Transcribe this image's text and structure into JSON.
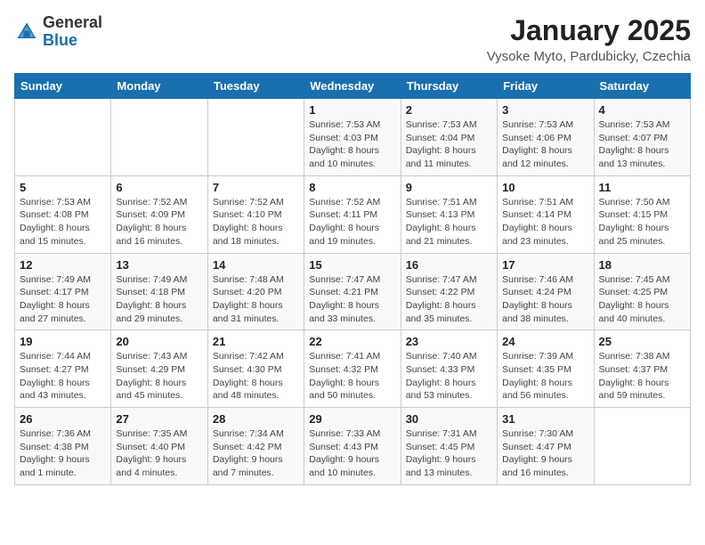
{
  "logo": {
    "general": "General",
    "blue": "Blue"
  },
  "title": "January 2025",
  "subtitle": "Vysoke Myto, Pardubicky, Czechia",
  "days_of_week": [
    "Sunday",
    "Monday",
    "Tuesday",
    "Wednesday",
    "Thursday",
    "Friday",
    "Saturday"
  ],
  "weeks": [
    [
      {
        "day": "",
        "info": ""
      },
      {
        "day": "",
        "info": ""
      },
      {
        "day": "",
        "info": ""
      },
      {
        "day": "1",
        "info": "Sunrise: 7:53 AM\nSunset: 4:03 PM\nDaylight: 8 hours and 10 minutes."
      },
      {
        "day": "2",
        "info": "Sunrise: 7:53 AM\nSunset: 4:04 PM\nDaylight: 8 hours and 11 minutes."
      },
      {
        "day": "3",
        "info": "Sunrise: 7:53 AM\nSunset: 4:06 PM\nDaylight: 8 hours and 12 minutes."
      },
      {
        "day": "4",
        "info": "Sunrise: 7:53 AM\nSunset: 4:07 PM\nDaylight: 8 hours and 13 minutes."
      }
    ],
    [
      {
        "day": "5",
        "info": "Sunrise: 7:53 AM\nSunset: 4:08 PM\nDaylight: 8 hours and 15 minutes."
      },
      {
        "day": "6",
        "info": "Sunrise: 7:52 AM\nSunset: 4:09 PM\nDaylight: 8 hours and 16 minutes."
      },
      {
        "day": "7",
        "info": "Sunrise: 7:52 AM\nSunset: 4:10 PM\nDaylight: 8 hours and 18 minutes."
      },
      {
        "day": "8",
        "info": "Sunrise: 7:52 AM\nSunset: 4:11 PM\nDaylight: 8 hours and 19 minutes."
      },
      {
        "day": "9",
        "info": "Sunrise: 7:51 AM\nSunset: 4:13 PM\nDaylight: 8 hours and 21 minutes."
      },
      {
        "day": "10",
        "info": "Sunrise: 7:51 AM\nSunset: 4:14 PM\nDaylight: 8 hours and 23 minutes."
      },
      {
        "day": "11",
        "info": "Sunrise: 7:50 AM\nSunset: 4:15 PM\nDaylight: 8 hours and 25 minutes."
      }
    ],
    [
      {
        "day": "12",
        "info": "Sunrise: 7:49 AM\nSunset: 4:17 PM\nDaylight: 8 hours and 27 minutes."
      },
      {
        "day": "13",
        "info": "Sunrise: 7:49 AM\nSunset: 4:18 PM\nDaylight: 8 hours and 29 minutes."
      },
      {
        "day": "14",
        "info": "Sunrise: 7:48 AM\nSunset: 4:20 PM\nDaylight: 8 hours and 31 minutes."
      },
      {
        "day": "15",
        "info": "Sunrise: 7:47 AM\nSunset: 4:21 PM\nDaylight: 8 hours and 33 minutes."
      },
      {
        "day": "16",
        "info": "Sunrise: 7:47 AM\nSunset: 4:22 PM\nDaylight: 8 hours and 35 minutes."
      },
      {
        "day": "17",
        "info": "Sunrise: 7:46 AM\nSunset: 4:24 PM\nDaylight: 8 hours and 38 minutes."
      },
      {
        "day": "18",
        "info": "Sunrise: 7:45 AM\nSunset: 4:25 PM\nDaylight: 8 hours and 40 minutes."
      }
    ],
    [
      {
        "day": "19",
        "info": "Sunrise: 7:44 AM\nSunset: 4:27 PM\nDaylight: 8 hours and 43 minutes."
      },
      {
        "day": "20",
        "info": "Sunrise: 7:43 AM\nSunset: 4:29 PM\nDaylight: 8 hours and 45 minutes."
      },
      {
        "day": "21",
        "info": "Sunrise: 7:42 AM\nSunset: 4:30 PM\nDaylight: 8 hours and 48 minutes."
      },
      {
        "day": "22",
        "info": "Sunrise: 7:41 AM\nSunset: 4:32 PM\nDaylight: 8 hours and 50 minutes."
      },
      {
        "day": "23",
        "info": "Sunrise: 7:40 AM\nSunset: 4:33 PM\nDaylight: 8 hours and 53 minutes."
      },
      {
        "day": "24",
        "info": "Sunrise: 7:39 AM\nSunset: 4:35 PM\nDaylight: 8 hours and 56 minutes."
      },
      {
        "day": "25",
        "info": "Sunrise: 7:38 AM\nSunset: 4:37 PM\nDaylight: 8 hours and 59 minutes."
      }
    ],
    [
      {
        "day": "26",
        "info": "Sunrise: 7:36 AM\nSunset: 4:38 PM\nDaylight: 9 hours and 1 minute."
      },
      {
        "day": "27",
        "info": "Sunrise: 7:35 AM\nSunset: 4:40 PM\nDaylight: 9 hours and 4 minutes."
      },
      {
        "day": "28",
        "info": "Sunrise: 7:34 AM\nSunset: 4:42 PM\nDaylight: 9 hours and 7 minutes."
      },
      {
        "day": "29",
        "info": "Sunrise: 7:33 AM\nSunset: 4:43 PM\nDaylight: 9 hours and 10 minutes."
      },
      {
        "day": "30",
        "info": "Sunrise: 7:31 AM\nSunset: 4:45 PM\nDaylight: 9 hours and 13 minutes."
      },
      {
        "day": "31",
        "info": "Sunrise: 7:30 AM\nSunset: 4:47 PM\nDaylight: 9 hours and 16 minutes."
      },
      {
        "day": "",
        "info": ""
      }
    ]
  ]
}
